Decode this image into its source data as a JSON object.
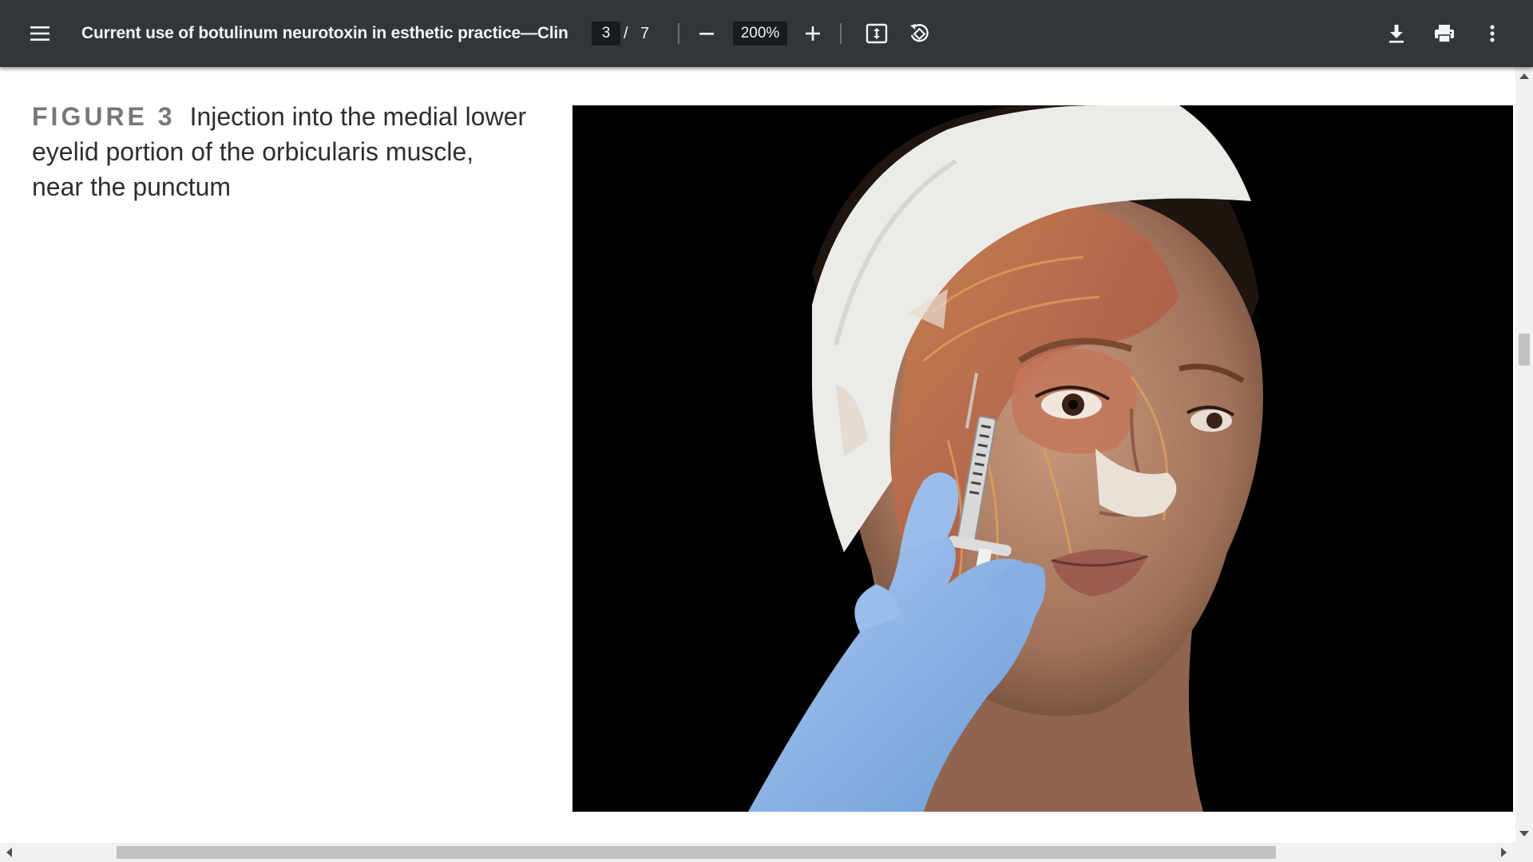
{
  "toolbar": {
    "menu_icon": "menu-icon",
    "title": "Current use of botulinum neurotoxin in esthetic practice—Clinic...",
    "page_current": "3",
    "page_separator": "/",
    "page_total": "7",
    "zoom_value": "200%",
    "icons": {
      "zoom_out": "minus-icon",
      "zoom_in": "plus-icon",
      "fit": "fit-page-icon",
      "rotate": "rotate-icon",
      "download": "download-icon",
      "print": "print-icon",
      "more": "more-vert-icon"
    }
  },
  "document": {
    "figure_label": "FIGURE 3",
    "figure_caption": "Injection into the medial lower eyelid portion of the orbicularis muscle, near the punctum"
  },
  "colors": {
    "toolbar_bg": "#323639",
    "toolbar_text": "#f1f3f4",
    "input_bg": "#191b1c",
    "scrollbar_thumb": "#c1c1c1",
    "glove_blue": "#8db4e6"
  }
}
